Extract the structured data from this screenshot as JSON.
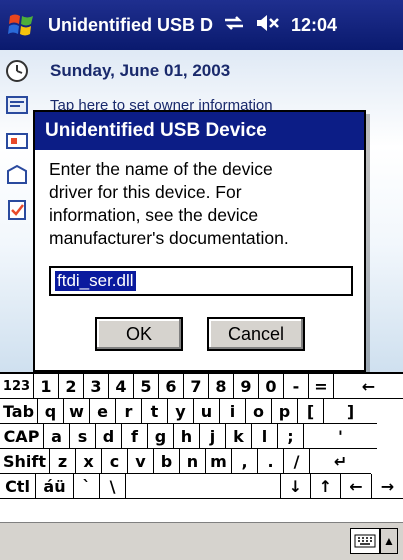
{
  "taskbar": {
    "title": "Unidentified USB D",
    "time": "12:04",
    "icons": [
      "windows-start-icon",
      "connectivity-icon",
      "volume-muted-icon"
    ]
  },
  "today": {
    "date": "Sunday, June 01, 2003",
    "owner_info": "Tap here to set owner information"
  },
  "dialog": {
    "title": "Unidentified USB Device",
    "line1": "Enter the name of the device",
    "line2": "driver for this device. For",
    "line3": "information, see the device",
    "line4": "manufacturer's documentation.",
    "input_value": "ftdi_ser.dll",
    "ok_label": "OK",
    "cancel_label": "Cancel"
  },
  "keyboard": {
    "rows": [
      [
        "123",
        "1",
        "2",
        "3",
        "4",
        "5",
        "6",
        "7",
        "8",
        "9",
        "0",
        "-",
        "=",
        "←"
      ],
      [
        "Tab",
        "q",
        "w",
        "e",
        "r",
        "t",
        "y",
        "u",
        "i",
        "o",
        "p",
        "[",
        "]"
      ],
      [
        "CAP",
        "a",
        "s",
        "d",
        "f",
        "g",
        "h",
        "j",
        "k",
        "l",
        ";",
        "'"
      ],
      [
        "Shift",
        "z",
        "x",
        "c",
        "v",
        "b",
        "n",
        "m",
        ",",
        ".",
        "/",
        "↵"
      ],
      [
        "Ctl",
        "áü",
        "`",
        "\\",
        "",
        "↓",
        "↑",
        "←",
        "→"
      ]
    ]
  },
  "menubar": {
    "input_icon": "keyboard-icon",
    "arrow": "▲"
  }
}
